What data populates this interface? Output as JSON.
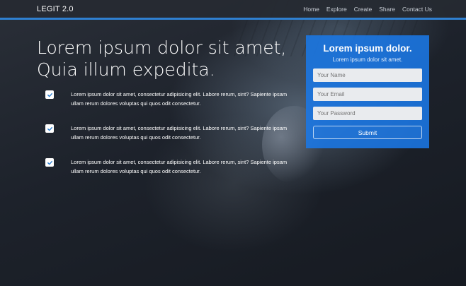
{
  "nav": {
    "brand": "LEGIT 2.0",
    "links": [
      "Home",
      "Explore",
      "Create",
      "Share",
      "Contact Us"
    ]
  },
  "hero": {
    "heading_line1": "Lorem ipsum dolor sit amet,",
    "heading_line2": "Quia illum expedita."
  },
  "features": [
    {
      "text": "Lorem ipsum dolor sit amet, consectetur adipisicing elit. Labore rerum, sint? Sapiente ipsam ullam rerum dolores voluptas qui quos odit consectetur."
    },
    {
      "text": "Lorem ipsum dolor sit amet, consectetur adipisicing elit. Labore rerum, sint? Sapiente ipsam ullam rerum dolores voluptas qui quos odit consectetur."
    },
    {
      "text": "Lorem ipsum dolor sit amet, consectetur adipisicing elit. Labore rerum, sint? Sapiente ipsam ullam rerum dolores voluptas qui quos odit consectetur."
    }
  ],
  "form": {
    "title": "Lorem ipsum dolor.",
    "subtitle": "Lorem ipsum dolor sit amet.",
    "name_placeholder": "Your Name",
    "email_placeholder": "Your Email",
    "password_placeholder": "Your Password",
    "submit_label": "Submit"
  },
  "colors": {
    "accent": "#2f80d1",
    "form_bg": "#1a78e6",
    "check_icon": "#2f80d1"
  },
  "icons": {
    "feature_check": "checkbox-check-icon"
  }
}
